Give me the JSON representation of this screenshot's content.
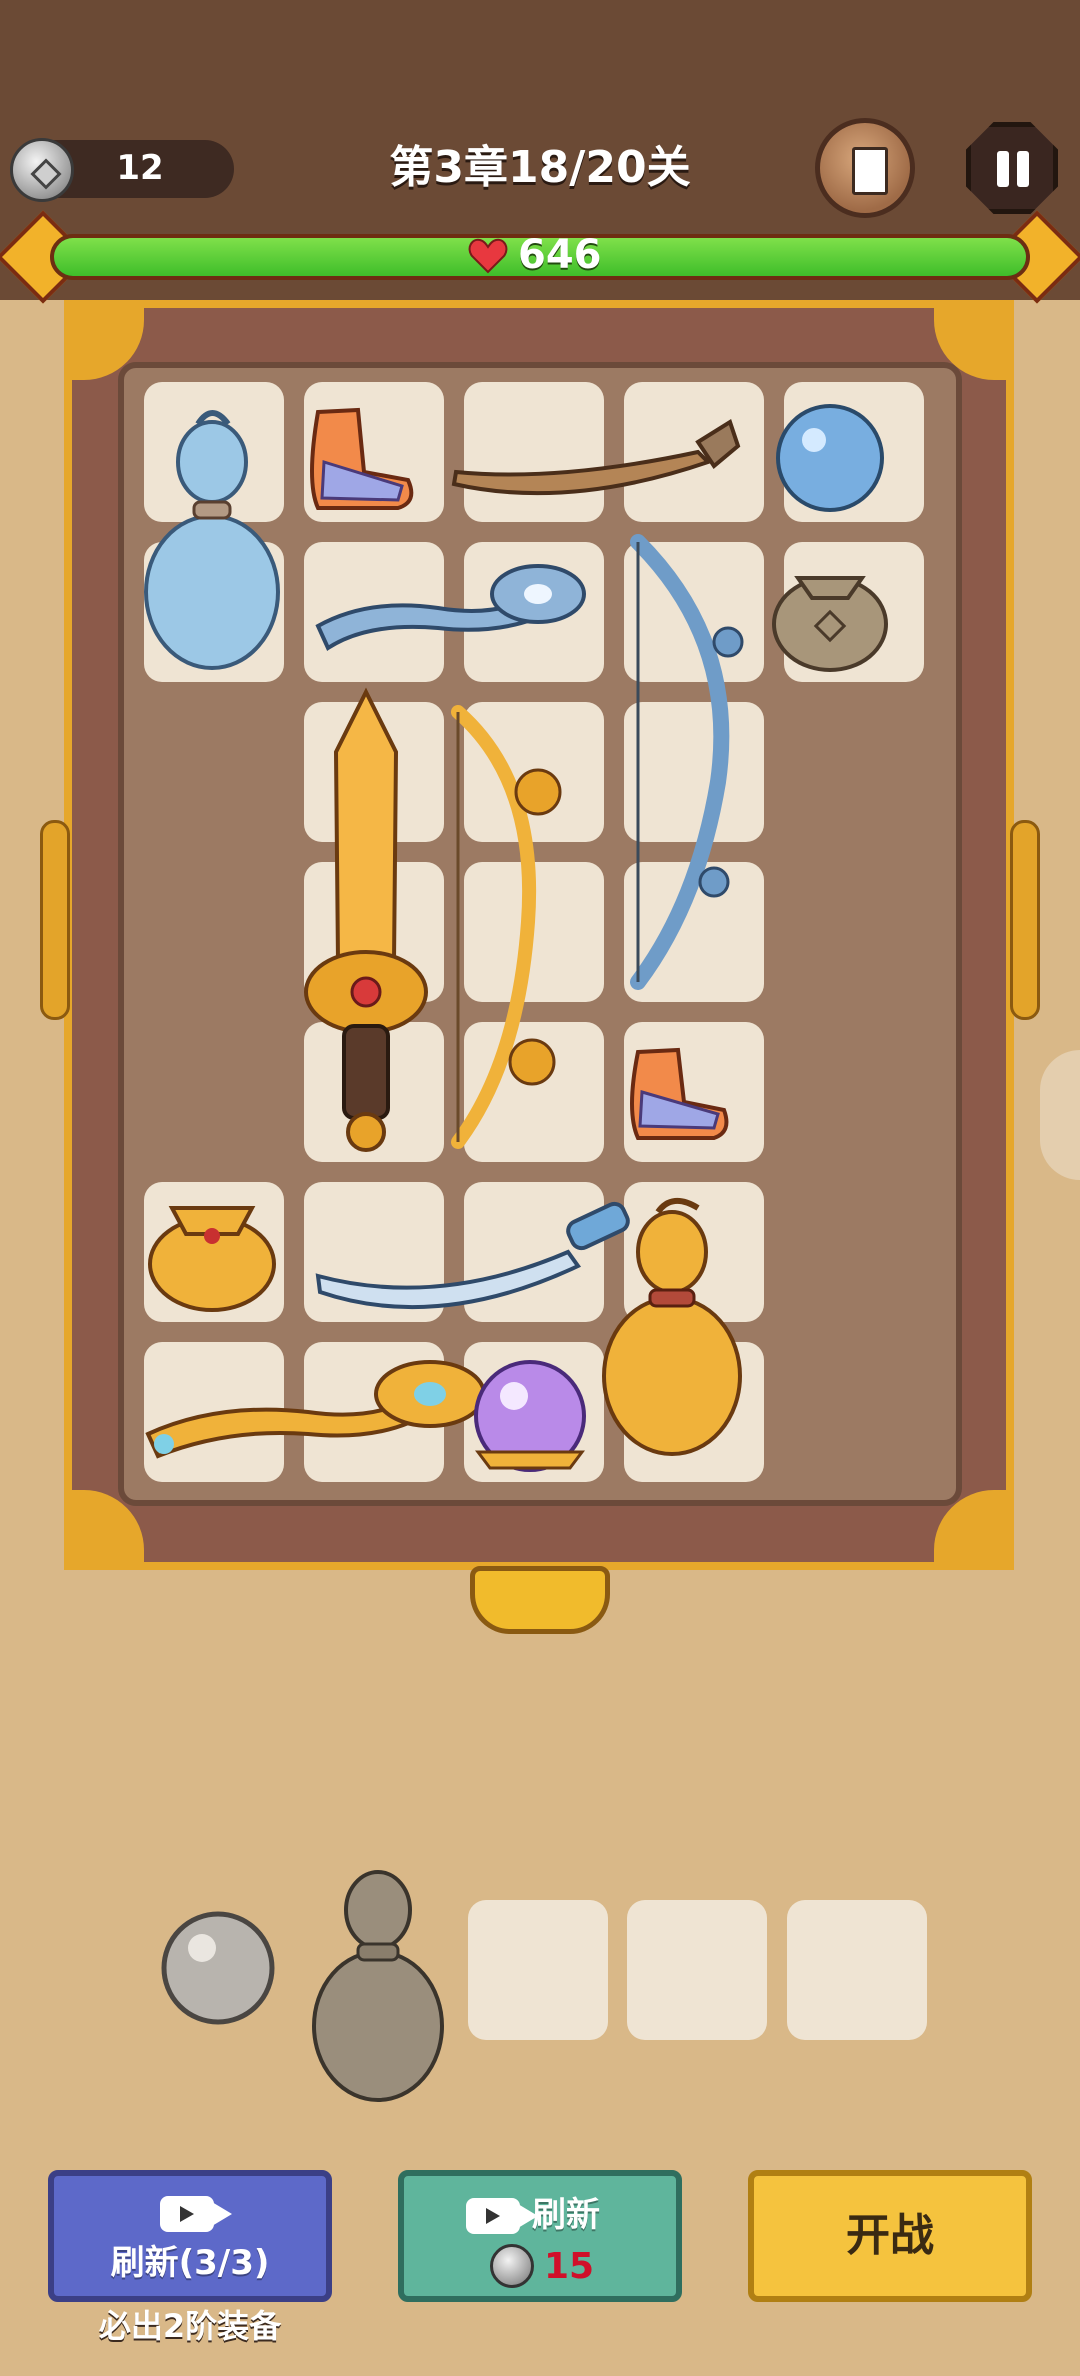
{
  "header": {
    "coin_count": "12",
    "level_title": "第3章18/20关",
    "hp_value": "646",
    "hp_fraction": 1.0
  },
  "icons": {
    "coin": "coin-icon",
    "book": "book-icon",
    "pause": "pause-icon",
    "heart": "heart-icon",
    "video": "video-icon"
  },
  "board": {
    "items": [
      {
        "name": "gourd-blue",
        "col": 0,
        "row": 0,
        "rowspan": 2
      },
      {
        "name": "boots-orange",
        "col": 1,
        "row": 0
      },
      {
        "name": "club-wood",
        "col": 2,
        "row": 0,
        "colspan": 2
      },
      {
        "name": "orb-blue",
        "col": 4,
        "row": 0
      },
      {
        "name": "scepter-blue",
        "col": 1,
        "row": 1,
        "colspan": 2
      },
      {
        "name": "bow-blue",
        "col": 3,
        "row": 1,
        "rowspan": 3
      },
      {
        "name": "money-bag",
        "col": 4,
        "row": 1
      },
      {
        "name": "sword-gold",
        "col": 1,
        "row": 2,
        "rowspan": 3
      },
      {
        "name": "bow-gold",
        "col": 2,
        "row": 2,
        "rowspan": 3
      },
      {
        "name": "boots-orange-2",
        "col": 3,
        "row": 4
      },
      {
        "name": "bag-gold",
        "col": 0,
        "row": 5
      },
      {
        "name": "scimitar-blue",
        "col": 1,
        "row": 5,
        "colspan": 2
      },
      {
        "name": "gourd-gold",
        "col": 3,
        "row": 5,
        "rowspan": 2
      },
      {
        "name": "scepter-gold",
        "col": 0,
        "row": 6,
        "colspan": 2
      },
      {
        "name": "crystal-orb",
        "col": 2,
        "row": 6
      }
    ]
  },
  "tray": {
    "items": [
      "grey-pearl",
      "grey-gourd"
    ],
    "empty_slots": 3
  },
  "buttons": {
    "refresh_ad_label": "刷新(3/3)",
    "refresh_ad_caption": "必出2阶装备",
    "refresh_coin_label": "刷新",
    "refresh_coin_cost": "15",
    "start_label": "开战"
  },
  "colors": {
    "hp_green": "#3fbe2a",
    "cost_red": "#d0102a",
    "board_frame_gold": "#e6a72b"
  }
}
